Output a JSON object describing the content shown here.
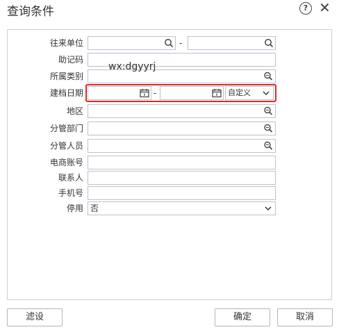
{
  "dialog": {
    "title": "查询条件",
    "help_symbol": "?",
    "close_symbol": "✕"
  },
  "watermark": "wx:dgyyrj",
  "fields": {
    "partner_label": "往来单位",
    "range_sep": "-",
    "mnemonic_label": "助记码",
    "category_label": "所属类别",
    "date_label": "建档日期",
    "date_range_option": "自定义",
    "region_label": "地区",
    "department_label": "分管部门",
    "staff_label": "分管人员",
    "ecommerce_label": "电商账号",
    "contact_label": "联系人",
    "mobile_label": "手机号",
    "disabled_label": "停用",
    "disabled_value": "否"
  },
  "buttons": {
    "filter": "滤设",
    "ok": "确定",
    "cancel": "取消"
  },
  "icons": {
    "search": "search-icon",
    "lookup": "lookup-icon",
    "calendar": "calendar-icon",
    "chevron": "chevron-down-icon"
  },
  "colors": {
    "highlight": "#e02525",
    "border": "#b9c2cc"
  }
}
